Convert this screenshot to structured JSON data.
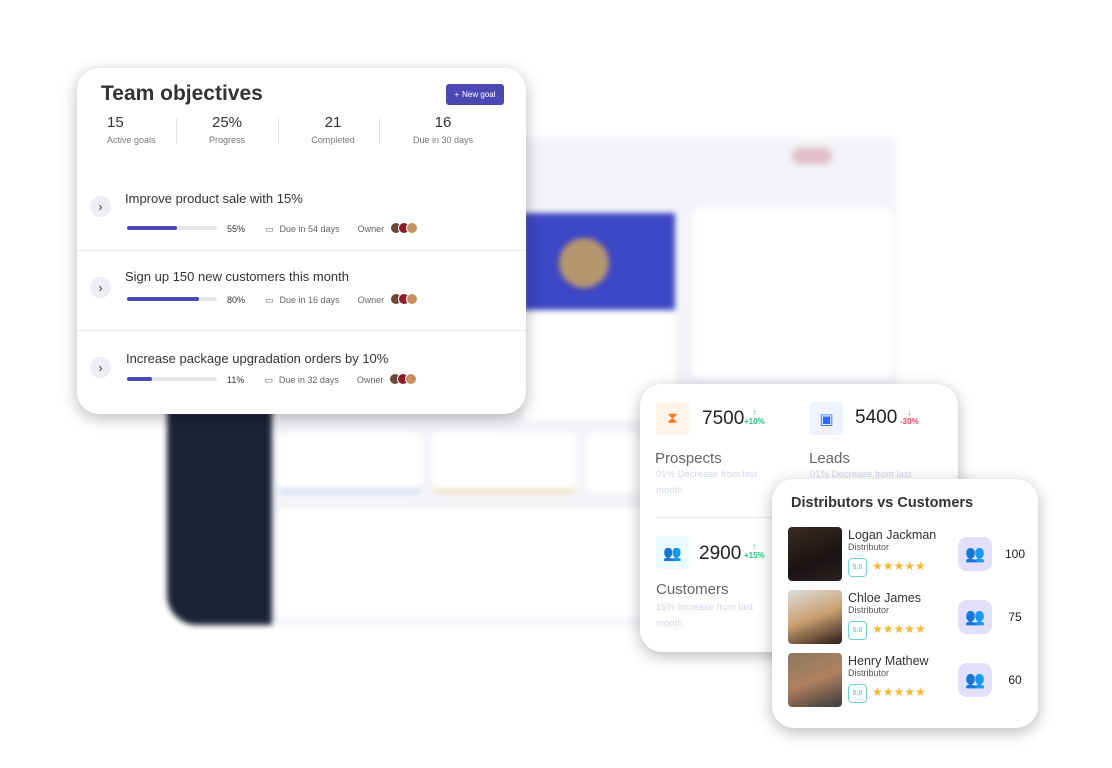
{
  "team_objectives": {
    "title": "Team objectives",
    "new_goal_label": "New goal",
    "stats": [
      {
        "value": "15",
        "label": "Active goals"
      },
      {
        "value": "25%",
        "label": "Progress"
      },
      {
        "value": "21",
        "label": "Completed"
      },
      {
        "value": "16",
        "label": "Due in 30 days"
      }
    ],
    "goals": [
      {
        "title": "Improve product sale with 15%",
        "progress": 55,
        "progress_label": "55%",
        "due": "Due in 54 days",
        "owner_label": "Owner"
      },
      {
        "title": "Sign up 150 new customers this month",
        "progress": 80,
        "progress_label": "80%",
        "due": "Due in 16 days",
        "owner_label": "Owner"
      },
      {
        "title": "Increase package upgradation orders by 10%",
        "progress": 11,
        "progress_label": "11%",
        "due": "Due in 32 days",
        "owner_label": "Owner"
      }
    ]
  },
  "metrics": [
    {
      "value": "7500",
      "change": "+10%",
      "direction": "up",
      "label": "Prospects",
      "note": "01% Decrease from last month",
      "icon": "hourglass-icon",
      "color": "#f47b2a"
    },
    {
      "value": "5400",
      "change": "-30%",
      "direction": "down",
      "label": "Leads",
      "note": "01% Decrease from last",
      "icon": "devices-icon",
      "color": "#2f6bff"
    },
    {
      "value": "2900",
      "change": "+15%",
      "direction": "up",
      "label": "Customers",
      "note": "15% Increase from last month",
      "icon": "users-icon",
      "color": "#1ec3f0"
    }
  ],
  "distributors": {
    "title": "Distributors vs Customers",
    "rows": [
      {
        "name": "Logan Jackman",
        "role": "Distributor",
        "rating": "5.0",
        "stars": 5,
        "customers": "100"
      },
      {
        "name": "Chloe James",
        "role": "Distributor",
        "rating": "5.0",
        "stars": 5,
        "customers": "75"
      },
      {
        "name": "Henry Mathew",
        "role": "Distributor",
        "rating": "5.0",
        "stars": 5,
        "customers": "60"
      }
    ]
  },
  "colors": {
    "accent": "#4b48b3",
    "up": "#22c97a",
    "down": "#f0476a",
    "star": "#f7b731"
  }
}
